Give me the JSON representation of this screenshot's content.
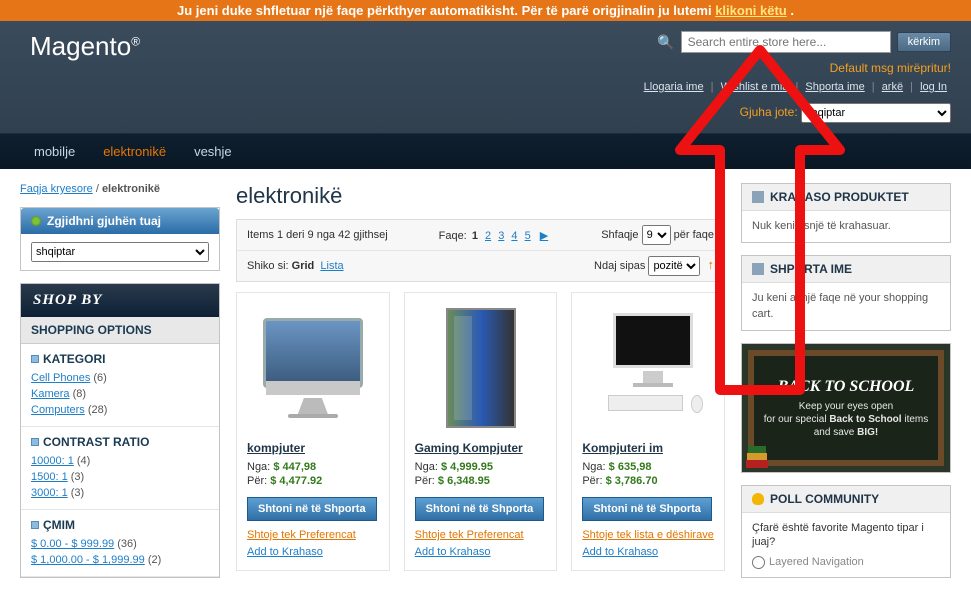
{
  "banner": {
    "text_before": "Ju jeni duke shfletuar një faqe përkthyer automatikisht. Për të parë origjinalin ju lutemi ",
    "link": "klikoni këtu",
    "text_after": " ."
  },
  "logo": {
    "text": "Magento",
    "reg": "®"
  },
  "search": {
    "placeholder": "Search entire store here...",
    "button": "kërkim"
  },
  "welcome": "Default msg mirëpritur!",
  "top_links": {
    "account": "Llogaria ime",
    "wishlist": "Wishlist e mia",
    "cart": "Shporta ime",
    "checkout": "arkë",
    "login": "log In"
  },
  "lang_header": {
    "label": "Gjuha jote:",
    "selected": "shqiptar"
  },
  "nav": {
    "items": [
      "mobilje",
      "elektronikë",
      "veshje"
    ],
    "active_index": 1
  },
  "breadcrumbs": {
    "home": "Faqja kryesore",
    "current": "elektronikë"
  },
  "lang_block": {
    "title": "Zgjidhni gjuhën tuaj",
    "selected": "shqiptar"
  },
  "shopby": {
    "title": "SHOP BY",
    "options_title": "SHOPPING OPTIONS",
    "sections": [
      {
        "heading": "KATEGORI",
        "items": [
          {
            "label": "Cell Phones",
            "count": "(6)"
          },
          {
            "label": "Kamera",
            "count": "(8)"
          },
          {
            "label": "Computers",
            "count": "(28)"
          }
        ]
      },
      {
        "heading": "CONTRAST RATIO",
        "items": [
          {
            "label": "10000: 1",
            "count": "(4)"
          },
          {
            "label": "1500: 1",
            "count": "(3)"
          },
          {
            "label": "3000: 1",
            "count": "(3)"
          }
        ]
      },
      {
        "heading": "ÇMIM",
        "items": [
          {
            "label": "$ 0.00 - $ 999.99",
            "count": "(36)"
          },
          {
            "label": "$ 1,000.00 - $ 1,999.99",
            "count": "(2)"
          }
        ]
      }
    ]
  },
  "page_title": "elektronikë",
  "toolbar": {
    "count_text": "Items 1 deri 9 nga 42 gjithsej",
    "page_label": "Faqe:",
    "pages": [
      "1",
      "2",
      "3",
      "4",
      "5"
    ],
    "show_label": "Shfaqje",
    "show_value": "9",
    "per_page": "për faqe",
    "view_label": "Shiko si:",
    "view_grid": "Grid",
    "view_list": "Lista",
    "sort_label": "Ndaj sipas",
    "sort_value": "pozitë"
  },
  "products": [
    {
      "name": "kompjuter",
      "from_label": "Nga:",
      "from_price": "$ 447,98",
      "to_label": "Për:",
      "to_price": "$ 4,477.92",
      "cart_btn": "Shtoni në të Shporta",
      "wishlist": "Shtoje tek Preferencat",
      "compare": "Add to Krahaso"
    },
    {
      "name": "Gaming Kompjuter",
      "from_label": "Nga:",
      "from_price": "$ 4,999.95",
      "to_label": "Për:",
      "to_price": "$ 6,348.95",
      "cart_btn": "Shtoni në të Shporta",
      "wishlist": "Shtoje tek Preferencat",
      "compare": "Add to Krahaso"
    },
    {
      "name": "Kompjuteri im",
      "from_label": "Nga:",
      "from_price": "$ 635,98",
      "to_label": "Për:",
      "to_price": "$ 3,786.70",
      "cart_btn": "Shtoni në të Shporta",
      "wishlist": "Shtoje tek lista e dëshirave",
      "compare": "Add to Krahaso"
    }
  ],
  "compare_block": {
    "title": "KRAHASO PRODUKTET",
    "text": "Nuk keni asnjë të krahasuar."
  },
  "cart_block": {
    "title": "SHPORTA IME",
    "text": "Ju keni asnjë faqe në your shopping cart."
  },
  "promo": {
    "title": "BACK TO SCHOOL",
    "line1": "Keep your eyes open",
    "line2": "for our special",
    "bold1": "Back to School",
    "line3": "items and save",
    "bold2": "BIG!"
  },
  "poll": {
    "title": "POLL COMMUNITY",
    "question": "Çfarë është favorite Magento tipar i juaj?",
    "option": "Layered Navigation"
  }
}
